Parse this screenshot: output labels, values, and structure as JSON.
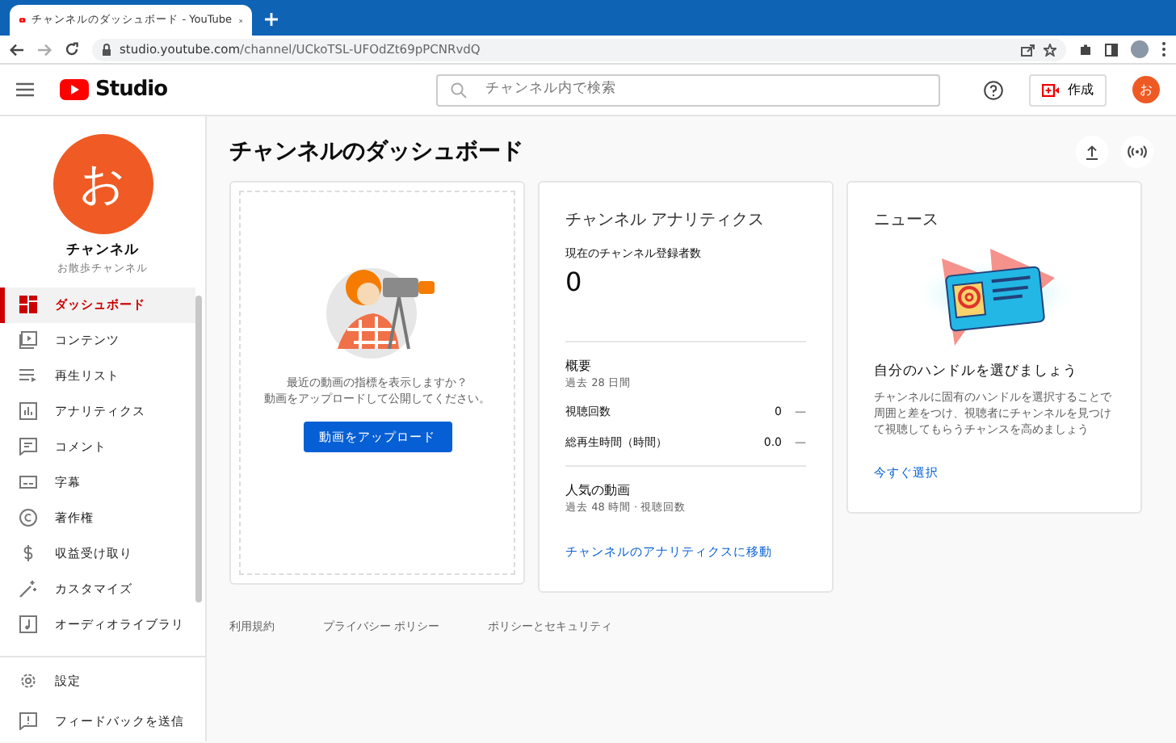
{
  "browser": {
    "tab_title": "チャンネルのダッシュボード - YouTube",
    "url_host": "studio.youtube.com",
    "url_path": "/channel/UCkoTSL-UFOdZt69pPCNRvdQ"
  },
  "header": {
    "logo_text": "Studio",
    "search_placeholder": "チャンネル内で検索",
    "create_label": "作成",
    "avatar_letter": "お"
  },
  "sidebar": {
    "avatar_letter": "お",
    "channel_name": "チャンネル",
    "channel_subtitle": "お散歩チャンネル",
    "items": [
      {
        "label": "ダッシュボード",
        "kind": "dashboard",
        "selected": true
      },
      {
        "label": "コンテンツ",
        "kind": "content",
        "selected": false
      },
      {
        "label": "再生リスト",
        "kind": "playlist",
        "selected": false
      },
      {
        "label": "アナリティクス",
        "kind": "analytics",
        "selected": false
      },
      {
        "label": "コメント",
        "kind": "comment",
        "selected": false
      },
      {
        "label": "字幕",
        "kind": "subtitles",
        "selected": false
      },
      {
        "label": "著作権",
        "kind": "copyright",
        "selected": false
      },
      {
        "label": "収益受け取り",
        "kind": "money",
        "selected": false
      },
      {
        "label": "カスタマイズ",
        "kind": "customize",
        "selected": false
      },
      {
        "label": "オーディオライブラリ",
        "kind": "audio",
        "selected": false
      }
    ],
    "footer_items": [
      {
        "label": "設定",
        "kind": "settings"
      },
      {
        "label": "フィードバックを送信",
        "kind": "feedback"
      }
    ]
  },
  "page_title": "チャンネルのダッシュボード",
  "upload_card": {
    "lines": [
      "最近の動画の指標を表示しますか？",
      "動画をアップロードして公開してください。"
    ],
    "button": "動画をアップロード"
  },
  "analytics": {
    "title": "チャンネル アナリティクス",
    "subscribers_label": "現在のチャンネル登録者数",
    "subscribers_value": "0",
    "summary_title": "概要",
    "summary_period": "過去 28 日間",
    "metrics": [
      {
        "label": "視聴回数",
        "value": "0",
        "trend": "—"
      },
      {
        "label": "総再生時間（時間）",
        "value": "0.0",
        "trend": "—"
      }
    ],
    "popular_title": "人気の動画",
    "popular_period": "過去 48 時間 · 視聴回数",
    "link": "チャンネルのアナリティクスに移動"
  },
  "news": {
    "title": "ニュース",
    "headline": "自分のハンドルを選びましょう",
    "body": "チャンネルに固有のハンドルを選択することで周囲と差をつけ、視聴者にチャンネルを見つけて視聴してもらうチャンスを高めましょう",
    "link": "今すぐ選択"
  },
  "footer_links": [
    "利用規約",
    "プライバシー ポリシー",
    "ポリシーとセキュリティ"
  ]
}
